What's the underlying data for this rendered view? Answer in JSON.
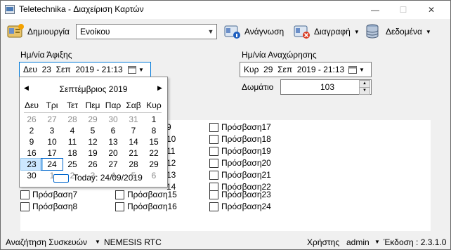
{
  "window": {
    "title": "Teletechnika - Διαχείριση Καρτών",
    "min": "—",
    "max": "☐",
    "close": "✕"
  },
  "toolbar": {
    "create_label": "Δημιουργία",
    "type_value": "Ενοίκου",
    "read_label": "Ανάγνωση",
    "delete_label": "Διαγραφή",
    "data_label": "Δεδομένα",
    "menu_arrow": "▼",
    "combo_arrow": "▼"
  },
  "arrival": {
    "label": "Ημ/νία Άφιξης",
    "value": "Δευ  23  Σεπ  2019 - 21:13"
  },
  "departure": {
    "label": "Ημ/νία Αναχώρησης",
    "value": "Κυρ  29  Σεπ  2019 - 21:13"
  },
  "room": {
    "label": "Δωμάτιο",
    "value": "103"
  },
  "calendar": {
    "prev": "◀",
    "next": "▶",
    "month_label": "Σεπτέμβριος 2019",
    "weekdays": [
      "Δευ",
      "Τρι",
      "Τετ",
      "Πεμ",
      "Παρ",
      "Σαβ",
      "Κυρ"
    ],
    "weeks": [
      [
        26,
        27,
        28,
        29,
        30,
        31,
        1
      ],
      [
        2,
        3,
        4,
        5,
        6,
        7,
        8
      ],
      [
        9,
        10,
        11,
        12,
        13,
        14,
        15
      ],
      [
        16,
        17,
        18,
        19,
        20,
        21,
        22
      ],
      [
        23,
        24,
        25,
        26,
        27,
        28,
        29
      ],
      [
        30,
        1,
        2,
        3,
        4,
        5,
        6
      ]
    ],
    "today_text": "Today: 24/09/2019"
  },
  "access": {
    "col1": [
      "Πρόσβαση7",
      "Πρόσβαση8"
    ],
    "col2_partial": [
      "9",
      "10",
      "11",
      "12",
      "13",
      "14"
    ],
    "col2": [
      "Πρόσβαση15",
      "Πρόσβαση16"
    ],
    "col3": [
      "Πρόσβαση17",
      "Πρόσβαση18",
      "Πρόσβαση19",
      "Πρόσβαση20",
      "Πρόσβαση21",
      "Πρόσβαση22",
      "Πρόσβαση23",
      "Πρόσβαση24"
    ]
  },
  "status": {
    "search_label": "Αναζήτηση Συσκευών",
    "arrow": "▼",
    "device": "NEMESIS RTC",
    "user_label": "Χρήστης",
    "user": "admin",
    "version": "Έκδοση : 2.3.1.0"
  }
}
